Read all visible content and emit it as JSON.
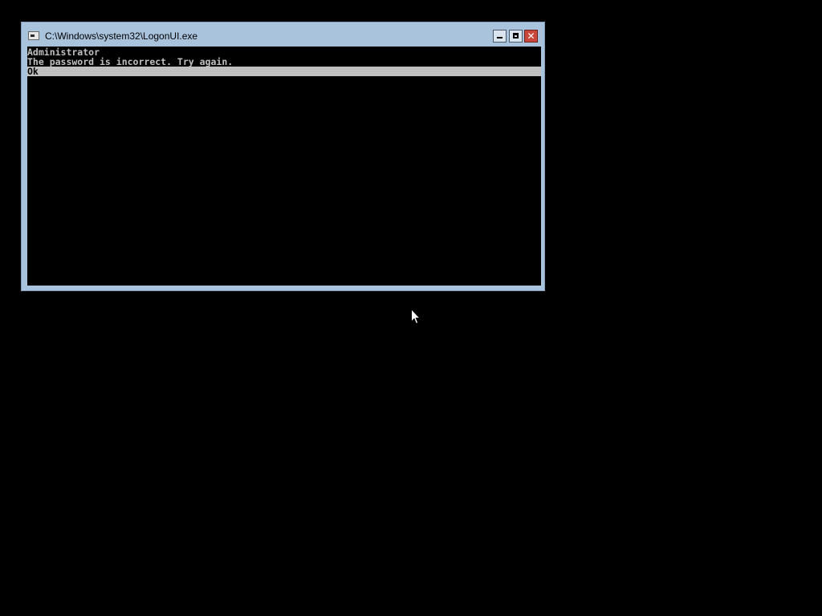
{
  "window": {
    "title": "C:\\Windows\\system32\\LogonUI.exe",
    "icon": "console-app-icon",
    "controls": {
      "minimize": "minimize-icon",
      "maximize": "maximize-icon",
      "close": "close-icon",
      "close_glyph": "✕"
    }
  },
  "console": {
    "lines": [
      "Administrator",
      "The password is incorrect. Try again."
    ],
    "selected_option": "Ok"
  },
  "colors": {
    "desktop_background": "#000000",
    "window_frame": "#a9c3dd",
    "console_text": "#c0c0c0",
    "highlight_bar": "#c0c0c0",
    "close_button": "#c9473b"
  },
  "cursor": "arrow-pointer-icon"
}
